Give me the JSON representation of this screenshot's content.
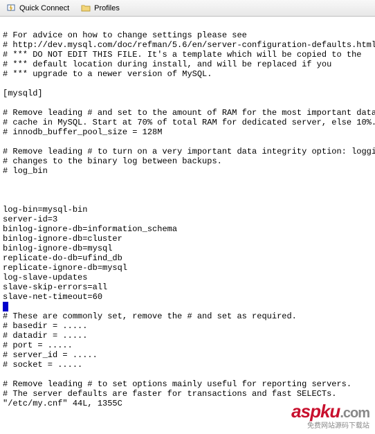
{
  "toolbar": {
    "quick_connect": "Quick Connect",
    "profiles": "Profiles"
  },
  "terminal": {
    "lines": [
      "# For advice on how to change settings please see",
      "# http://dev.mysql.com/doc/refman/5.6/en/server-configuration-defaults.html",
      "# *** DO NOT EDIT THIS FILE. It's a template which will be copied to the",
      "# *** default location during install, and will be replaced if you",
      "# *** upgrade to a newer version of MySQL.",
      "",
      "[mysqld]",
      "",
      "# Remove leading # and set to the amount of RAM for the most important data",
      "# cache in MySQL. Start at 70% of total RAM for dedicated server, else 10%.",
      "# innodb_buffer_pool_size = 128M",
      "",
      "# Remove leading # to turn on a very important data integrity option: logging",
      "# changes to the binary log between backups.",
      "# log_bin",
      "",
      "",
      "",
      "log-bin=mysql-bin",
      "server-id=3",
      "binlog-ignore-db=information_schema",
      "binlog-ignore-db=cluster",
      "binlog-ignore-db=mysql",
      "replicate-do-db=ufind_db",
      "replicate-ignore-db=mysql",
      "log-slave-updates",
      "slave-skip-errors=all",
      "slave-net-timeout=60"
    ],
    "lines_after_cursor": [
      "# These are commonly set, remove the # and set as required.",
      "# basedir = .....",
      "# datadir = .....",
      "# port = .....",
      "# server_id = .....",
      "# socket = .....",
      "",
      "# Remove leading # to set options mainly useful for reporting servers.",
      "# The server defaults are faster for transactions and fast SELECTs.",
      "\"/etc/my.cnf\" 44L, 1355C"
    ]
  },
  "watermark": {
    "brand_red": "aspku",
    "brand_grey": ".com",
    "tagline": "免费网站源码下载站"
  }
}
